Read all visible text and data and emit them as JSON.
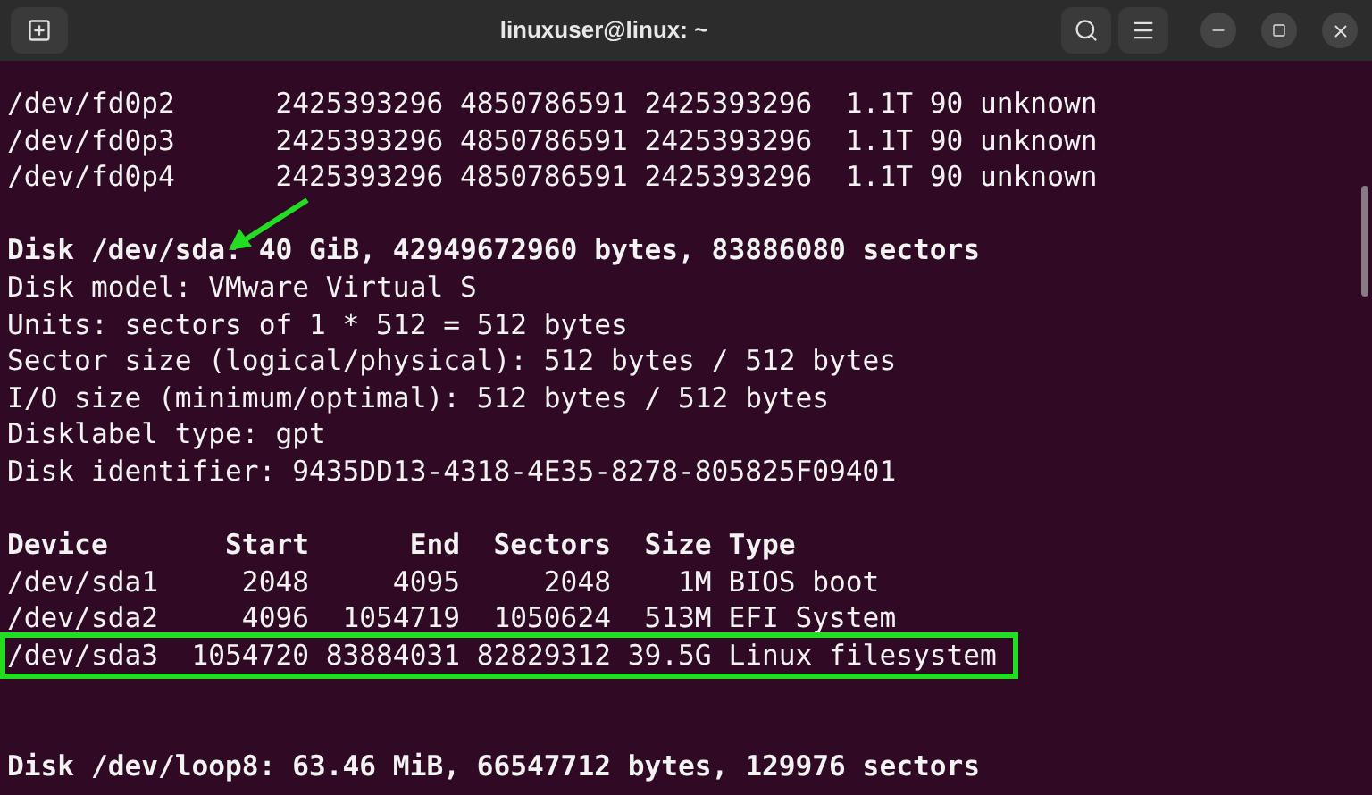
{
  "window": {
    "title": "linuxuser@linux: ~"
  },
  "lines": [
    {
      "kind": "plain",
      "text": "/dev/fd0p2      2425393296 4850786591 2425393296  1.1T 90 unknown"
    },
    {
      "kind": "plain",
      "text": "/dev/fd0p3      2425393296 4850786591 2425393296  1.1T 90 unknown"
    },
    {
      "kind": "plain",
      "text": "/dev/fd0p4      2425393296 4850786591 2425393296  1.1T 90 unknown"
    },
    {
      "kind": "blank"
    },
    {
      "kind": "heading",
      "text": "Disk /dev/sda: 40 GiB, 42949672960 bytes, 83886080 sectors"
    },
    {
      "kind": "plain",
      "text": "Disk model: VMware Virtual S"
    },
    {
      "kind": "plain",
      "text": "Units: sectors of 1 * 512 = 512 bytes"
    },
    {
      "kind": "plain",
      "text": "Sector size (logical/physical): 512 bytes / 512 bytes"
    },
    {
      "kind": "plain",
      "text": "I/O size (minimum/optimal): 512 bytes / 512 bytes"
    },
    {
      "kind": "plain",
      "text": "Disklabel type: gpt"
    },
    {
      "kind": "plain",
      "text": "Disk identifier: 9435DD13-4318-4E35-8278-805825F09401"
    },
    {
      "kind": "blank"
    },
    {
      "kind": "heading",
      "text": "Device       Start      End  Sectors  Size Type"
    },
    {
      "kind": "plain",
      "text": "/dev/sda1     2048     4095     2048    1M BIOS boot"
    },
    {
      "kind": "plain",
      "text": "/dev/sda2     4096  1054719  1050624  513M EFI System"
    },
    {
      "kind": "boxed",
      "text": "/dev/sda3  1054720 83884031 82829312 39.5G Linux filesystem"
    },
    {
      "kind": "blank"
    },
    {
      "kind": "blank"
    },
    {
      "kind": "heading",
      "text": "Disk /dev/loop8: 63.46 MiB, 66547712 bytes, 129976 sectors"
    }
  ]
}
